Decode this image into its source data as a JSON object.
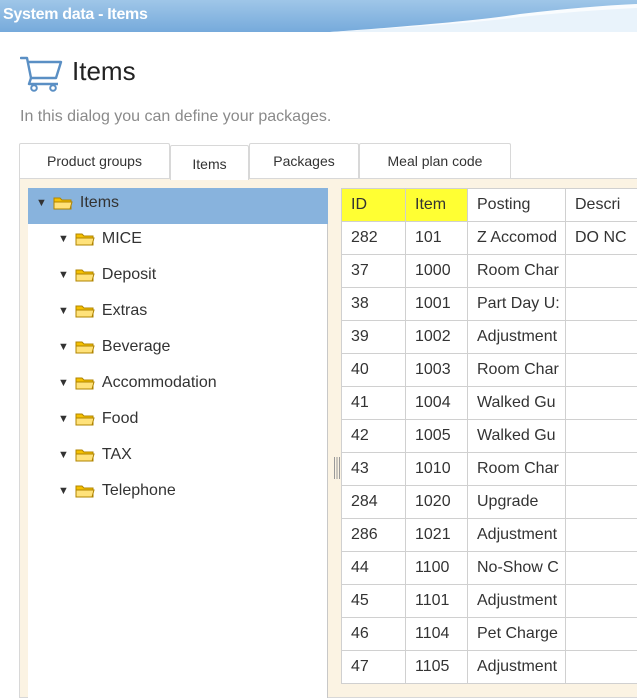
{
  "window": {
    "title": "System data - Items"
  },
  "header": {
    "icon": "cart-icon",
    "title": "Items"
  },
  "subtitle": "In this dialog you can define your packages.",
  "tabs": [
    {
      "label": "Product groups",
      "active": false
    },
    {
      "label": "Items",
      "active": true
    },
    {
      "label": "Packages",
      "active": false
    },
    {
      "label": "Meal plan code",
      "active": false
    }
  ],
  "tree": {
    "root": {
      "label": "Items",
      "icon": "folder-icon",
      "selected": true
    },
    "items": [
      {
        "label": "MICE"
      },
      {
        "label": "Deposit"
      },
      {
        "label": "Extras"
      },
      {
        "label": "Beverage"
      },
      {
        "label": "Accommodation"
      },
      {
        "label": "Food"
      },
      {
        "label": "TAX"
      },
      {
        "label": "Telephone"
      }
    ]
  },
  "table": {
    "columns": [
      "ID",
      "Item",
      "Posting",
      "Descri"
    ],
    "highlighted_columns": [
      "ID",
      "Item"
    ],
    "rows": [
      [
        "282",
        "101",
        "Z Accomod",
        "DO NC"
      ],
      [
        "37",
        "1000",
        "Room Char",
        ""
      ],
      [
        "38",
        "1001",
        "Part Day U:",
        ""
      ],
      [
        "39",
        "1002",
        "Adjustment",
        ""
      ],
      [
        "40",
        "1003",
        "Room Char",
        ""
      ],
      [
        "41",
        "1004",
        "Walked Gu",
        ""
      ],
      [
        "42",
        "1005",
        "Walked Gu",
        ""
      ],
      [
        "43",
        "1010",
        "Room Char",
        ""
      ],
      [
        "284",
        "1020",
        "Upgrade",
        ""
      ],
      [
        "286",
        "1021",
        "Adjustment",
        ""
      ],
      [
        "44",
        "1100",
        "No-Show C",
        ""
      ],
      [
        "45",
        "1101",
        "Adjustment",
        ""
      ],
      [
        "46",
        "1104",
        "Pet Charge",
        ""
      ],
      [
        "47",
        "1105",
        "Adjustment",
        ""
      ]
    ]
  },
  "colors": {
    "titlebar": "#88b8e2",
    "selection": "#88b3dd",
    "highlight": "#ffff33",
    "folder": "#f5c000",
    "panel_bg": "#fbf3e3"
  }
}
